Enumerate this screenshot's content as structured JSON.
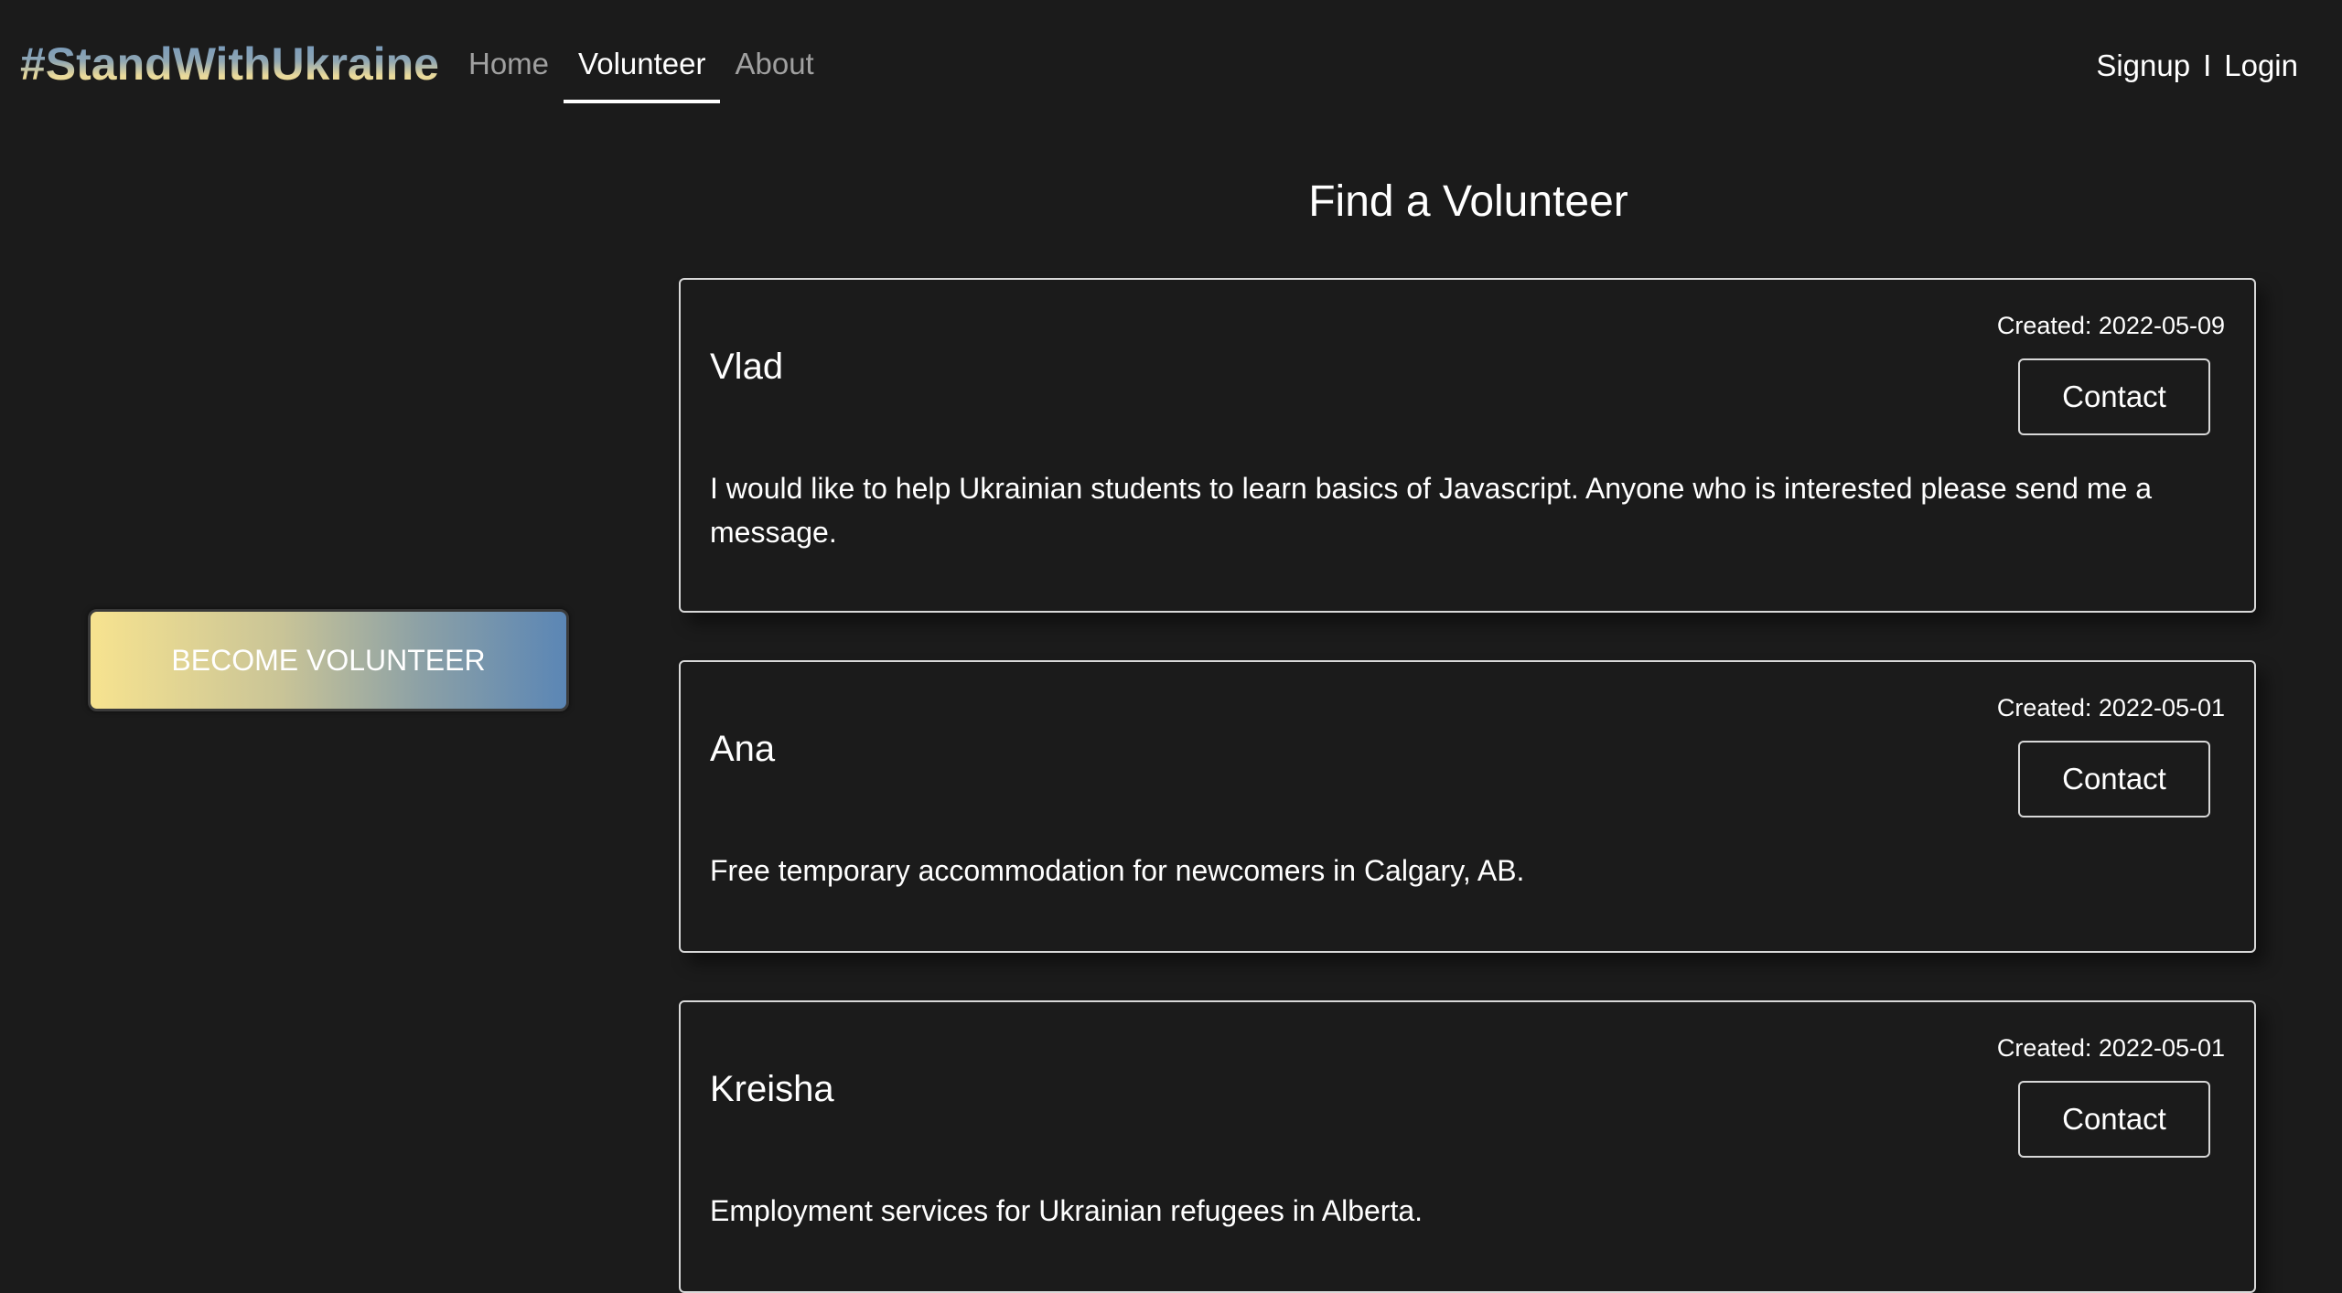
{
  "brand": "#StandWithUkraine",
  "nav": {
    "home": "Home",
    "volunteer": "Volunteer",
    "about": "About"
  },
  "auth": {
    "signup": "Signup",
    "separator": "I",
    "login": "Login"
  },
  "sidebar": {
    "become_volunteer": "BECOME VOLUNTEER"
  },
  "main": {
    "title": "Find a Volunteer",
    "cards": [
      {
        "name": "Vlad",
        "created": "Created: 2022-05-09",
        "contact": "Contact",
        "description": "I would like to help Ukrainian students to learn basics of Javascript. Anyone who is interested please send me a message."
      },
      {
        "name": "Ana",
        "created": "Created: 2022-05-01",
        "contact": "Contact",
        "description": "Free temporary accommodation for newcomers in Calgary, AB."
      },
      {
        "name": "Kreisha",
        "created": "Created: 2022-05-01",
        "contact": "Contact",
        "description": "Employment services for Ukrainian refugees in Alberta."
      }
    ]
  },
  "colors": {
    "background": "#1b1b1b",
    "gradient_yellow": "#f7e38f",
    "gradient_blue": "#5b86b5",
    "nav_inactive": "#a0a0a0"
  }
}
